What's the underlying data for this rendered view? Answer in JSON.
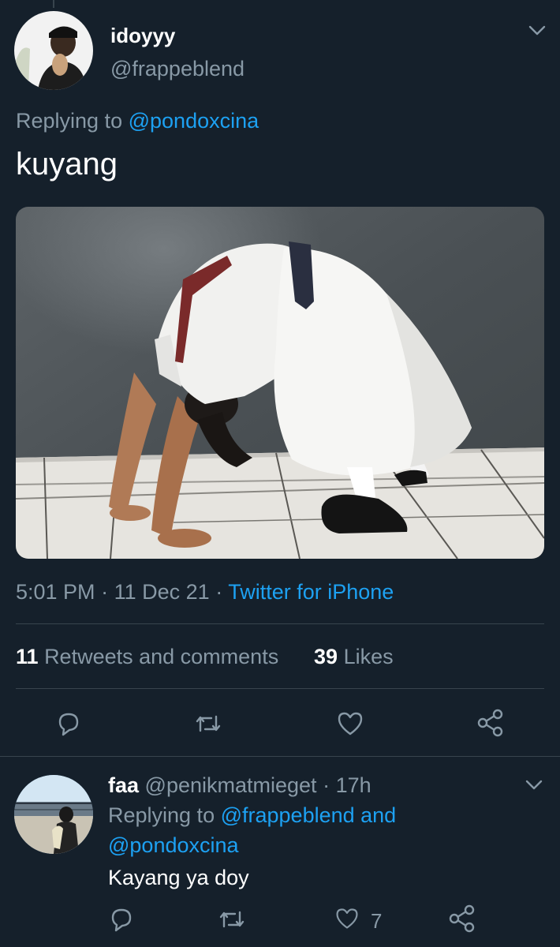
{
  "main_tweet": {
    "display_name": "idoyyy",
    "handle": "@frappeblend",
    "replying_prefix": "Replying to",
    "replying_to": "@pondoxcina",
    "text": "kuyang",
    "time": "5:01 PM",
    "date": "11 Dec 21",
    "separator": "·",
    "source": "Twitter for iPhone",
    "retweets_count": "11",
    "retweets_label": "Retweets and comments",
    "likes_count": "39",
    "likes_label": "Likes"
  },
  "reply_tweet": {
    "display_name": "faa",
    "handle": "@penikmatmieget",
    "age": "· 17h",
    "replying_prefix": "Replying to",
    "replying_to_1": "@frappeblend and",
    "replying_to_2": "@pondoxcina",
    "text": "Kayang ya doy",
    "like_count": "7"
  },
  "icons": {
    "reply": "reply-icon",
    "retweet": "retweet-icon",
    "like": "heart-icon",
    "share": "share-icon",
    "more": "chevron-down-icon"
  },
  "colors": {
    "background": "#15202b",
    "accent": "#1da1f2",
    "muted": "#8899a6",
    "divider": "#38444d"
  }
}
